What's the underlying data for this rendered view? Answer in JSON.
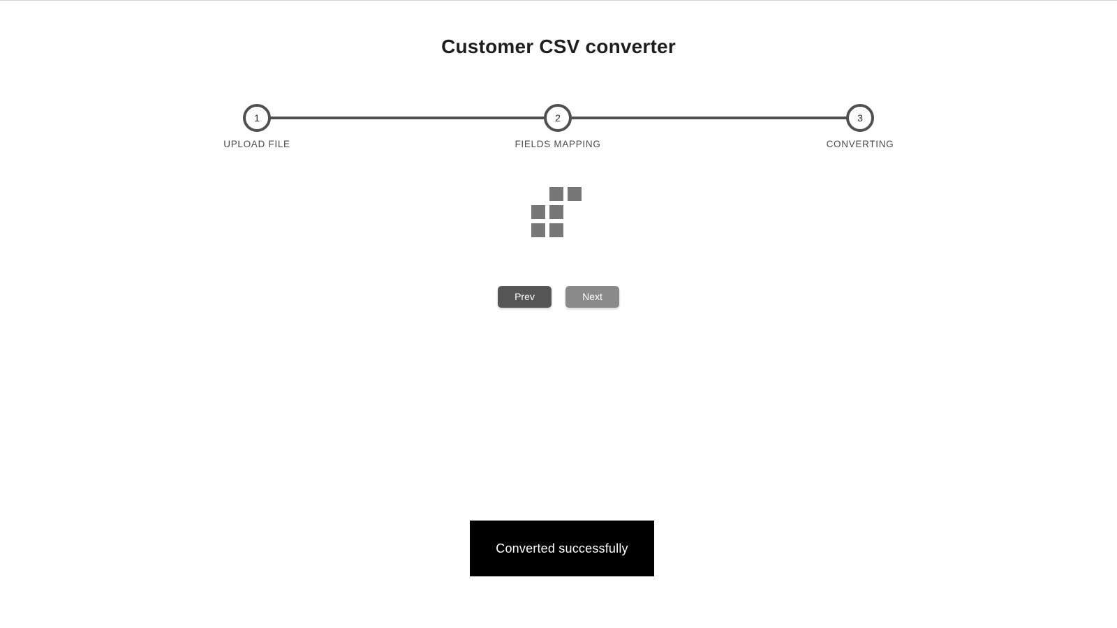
{
  "page": {
    "title": "Customer CSV converter"
  },
  "stepper": {
    "current_step": 3,
    "steps": [
      {
        "number": "1",
        "label": "UPLOAD FILE"
      },
      {
        "number": "2",
        "label": "FIELDS MAPPING"
      },
      {
        "number": "3",
        "label": "CONVERTING"
      }
    ]
  },
  "loader": {
    "icon": "loading-squares-icon"
  },
  "navigation": {
    "prev_label": "Prev",
    "next_label": "Next"
  },
  "toast": {
    "message": "Converted successfully"
  },
  "colors": {
    "accent": "#505050",
    "prev_button": "#555555",
    "next_button": "#8a8a8a",
    "loader_square": "#777777",
    "toast_background": "#000000",
    "toast_text": "#ffffff"
  }
}
